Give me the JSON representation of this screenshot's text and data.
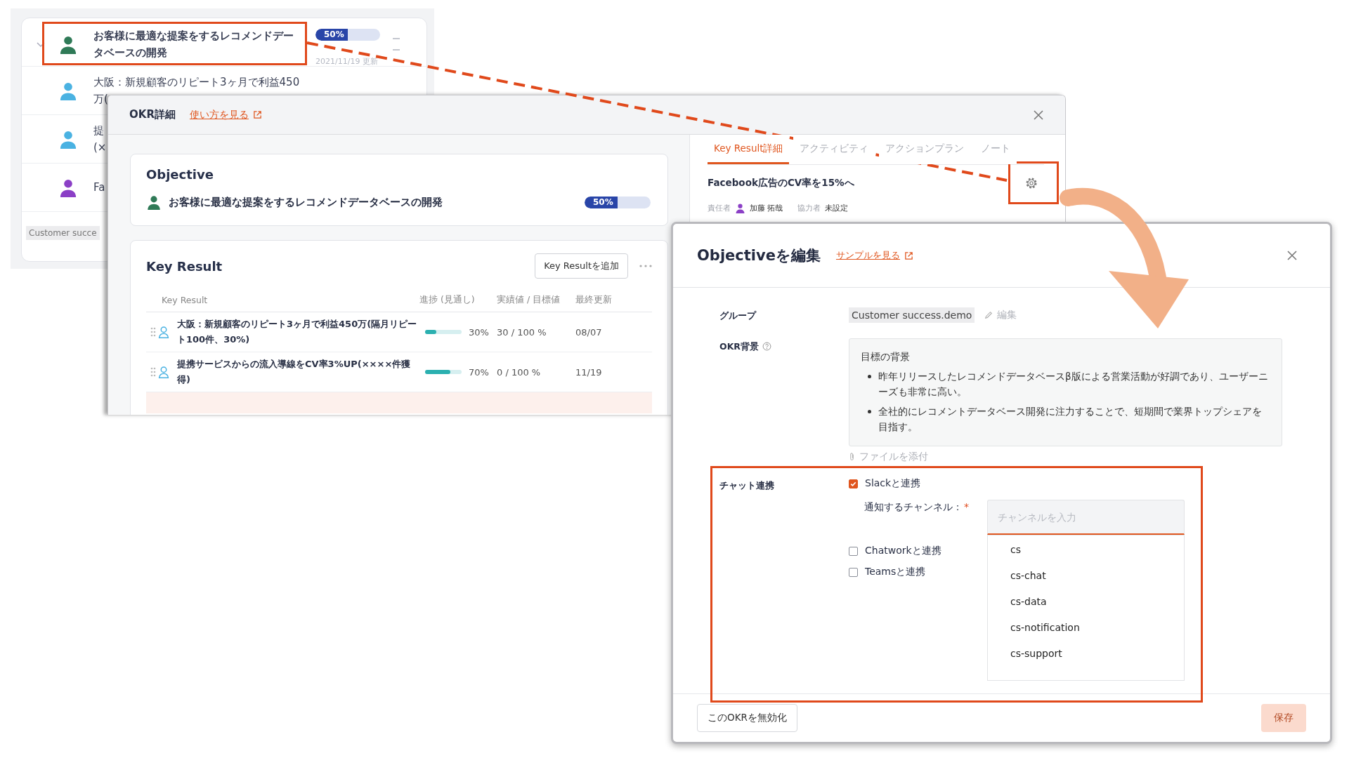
{
  "list_panel": {
    "rows": [
      {
        "kind": "objective",
        "expanded": true,
        "lines": [
          "お客様に最適な提案をするレコメンドデー",
          "タベースの開発"
        ],
        "color": "#2f7a57",
        "progress": {
          "label": "50%",
          "level": 0.5
        },
        "updated": "2021/11/19 更新"
      },
      {
        "kind": "key_result",
        "lines": [
          "大阪：新規顧客のリピート3ヶ月で利益450",
          "万("
        ],
        "color": "#4ab2e2"
      },
      {
        "kind": "key_result",
        "lines": [
          "提",
          "(×"
        ],
        "color": "#4ab2e2"
      },
      {
        "kind": "key_result",
        "lines": [
          "Fa"
        ],
        "color": "#8b3fc6"
      }
    ],
    "group_tag": "Customer succe"
  },
  "okr_detail": {
    "title": "OKR詳細",
    "help_link": "使い方を見る",
    "objective": {
      "heading": "Objective",
      "text": "お客様に最適な提案をするレコメンドデータベースの開発",
      "color": "#2f7a57",
      "progress": {
        "label": "50%",
        "level": 0.5
      }
    },
    "key_results": {
      "heading": "Key Result",
      "add_button": "Key Resultを追加",
      "columns": [
        "Key Result",
        "進捗 (見通し)",
        "実績値 / 目標値",
        "最終更新"
      ],
      "rows": [
        {
          "title": "大阪：新規顧客のリピート3ヶ月で利益450万(隔月リピート100件、30%)",
          "color": "#4ab2e2",
          "level": 0.3,
          "progress": "30%",
          "actual_target": "30 / 100 %",
          "updated": "08/07"
        },
        {
          "title": "提携サービスからの流入導線をCV率3%UP(××××件獲得)",
          "color": "#4ab2e2",
          "level": 0.7,
          "progress": "70%",
          "actual_target": "0 / 100 %",
          "updated": "11/19"
        }
      ]
    },
    "tabs": [
      {
        "label": "Key Result詳細",
        "selected": true
      },
      {
        "label": "アクティビティ",
        "selected": false
      },
      {
        "label": "アクションプラン",
        "selected": false
      },
      {
        "label": "ノート",
        "selected": false
      }
    ],
    "key_result": {
      "title": "Facebook広告のCV率を15%へ",
      "owner_label": "責任者",
      "owner": {
        "name": "加藤 拓哉",
        "color": "#8b3fc6"
      },
      "collaborator_label": "協力者",
      "collaborator": "未設定"
    }
  },
  "edit_dialog": {
    "title": "Objectiveを編集",
    "sample_link": "サンプルを見る",
    "group": {
      "label": "グループ",
      "value": "Customer success.demo",
      "edit": "編集"
    },
    "background": {
      "label": "OKR背景",
      "heading": "目標の背景",
      "bullets": [
        "昨年リリースしたレコメンドデータベースβ版による営業活動が好調であり、ユーザーニーズも非常に高い。",
        "全社的にレコメントデータベース開発に注力することで、短期間で業界トップシェアを目指す。"
      ]
    },
    "attach": "ファイルを添付",
    "chat": {
      "label": "チャット連携",
      "options": [
        {
          "label": "Slackと連携",
          "checked": true
        },
        {
          "label": "Chatworkと連携",
          "checked": false
        },
        {
          "label": "Teamsと連携",
          "checked": false
        }
      ],
      "channel": {
        "label": "通知するチャンネル：",
        "required_mark": "*",
        "placeholder": "チャンネルを入力",
        "suggestions": [
          "cs",
          "cs-chat",
          "cs-data",
          "cs-notification",
          "cs-support"
        ]
      }
    },
    "disable_button": "このOKRを無効化",
    "save_button": {
      "label": "保存",
      "disabled": true
    }
  }
}
